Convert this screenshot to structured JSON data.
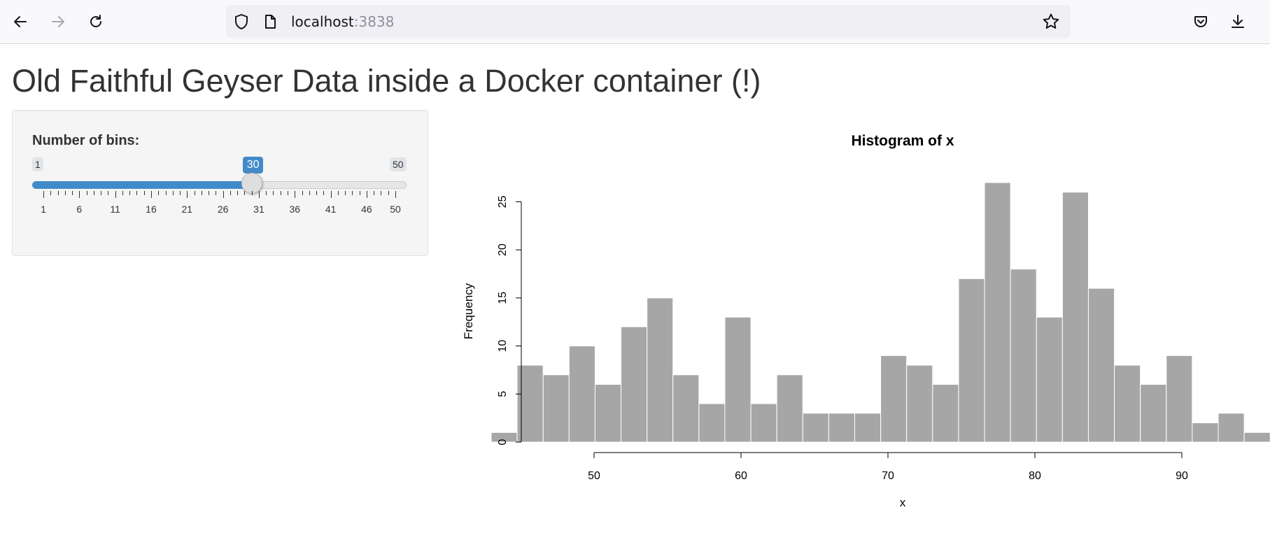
{
  "browser": {
    "url_host": "localhost",
    "url_port": ":3838",
    "icons": [
      "back-arrow-icon",
      "forward-arrow-icon",
      "reload-icon",
      "shield-icon",
      "page-icon",
      "star-icon",
      "pocket-icon",
      "download-icon"
    ]
  },
  "app": {
    "title": "Old Faithful Geyser Data inside a Docker container (!)",
    "slider": {
      "label": "Number of bins:",
      "min": 1,
      "max": 50,
      "value": 30,
      "min_label": "1",
      "max_label": "50",
      "value_label": "30",
      "ticks": [
        "1",
        "6",
        "11",
        "16",
        "21",
        "26",
        "31",
        "36",
        "41",
        "46",
        "50"
      ],
      "accent_color": "#428bca"
    }
  },
  "chart_data": {
    "type": "bar",
    "title": "Histogram of x",
    "xlabel": "x",
    "ylabel": "Frequency",
    "bar_color": "#a6a6a6",
    "bin_start": 43.0,
    "bin_width": 1.767,
    "values": [
      1,
      8,
      7,
      10,
      6,
      12,
      15,
      7,
      4,
      13,
      4,
      7,
      3,
      3,
      3,
      9,
      8,
      6,
      17,
      27,
      18,
      13,
      26,
      16,
      8,
      6,
      9,
      2,
      3,
      1
    ],
    "x_ticks": [
      "50",
      "60",
      "70",
      "80",
      "90"
    ],
    "y_ticks": [
      "0",
      "5",
      "10",
      "15",
      "20",
      "25"
    ],
    "xlim": [
      43,
      96
    ],
    "ylim": [
      0,
      27
    ]
  }
}
